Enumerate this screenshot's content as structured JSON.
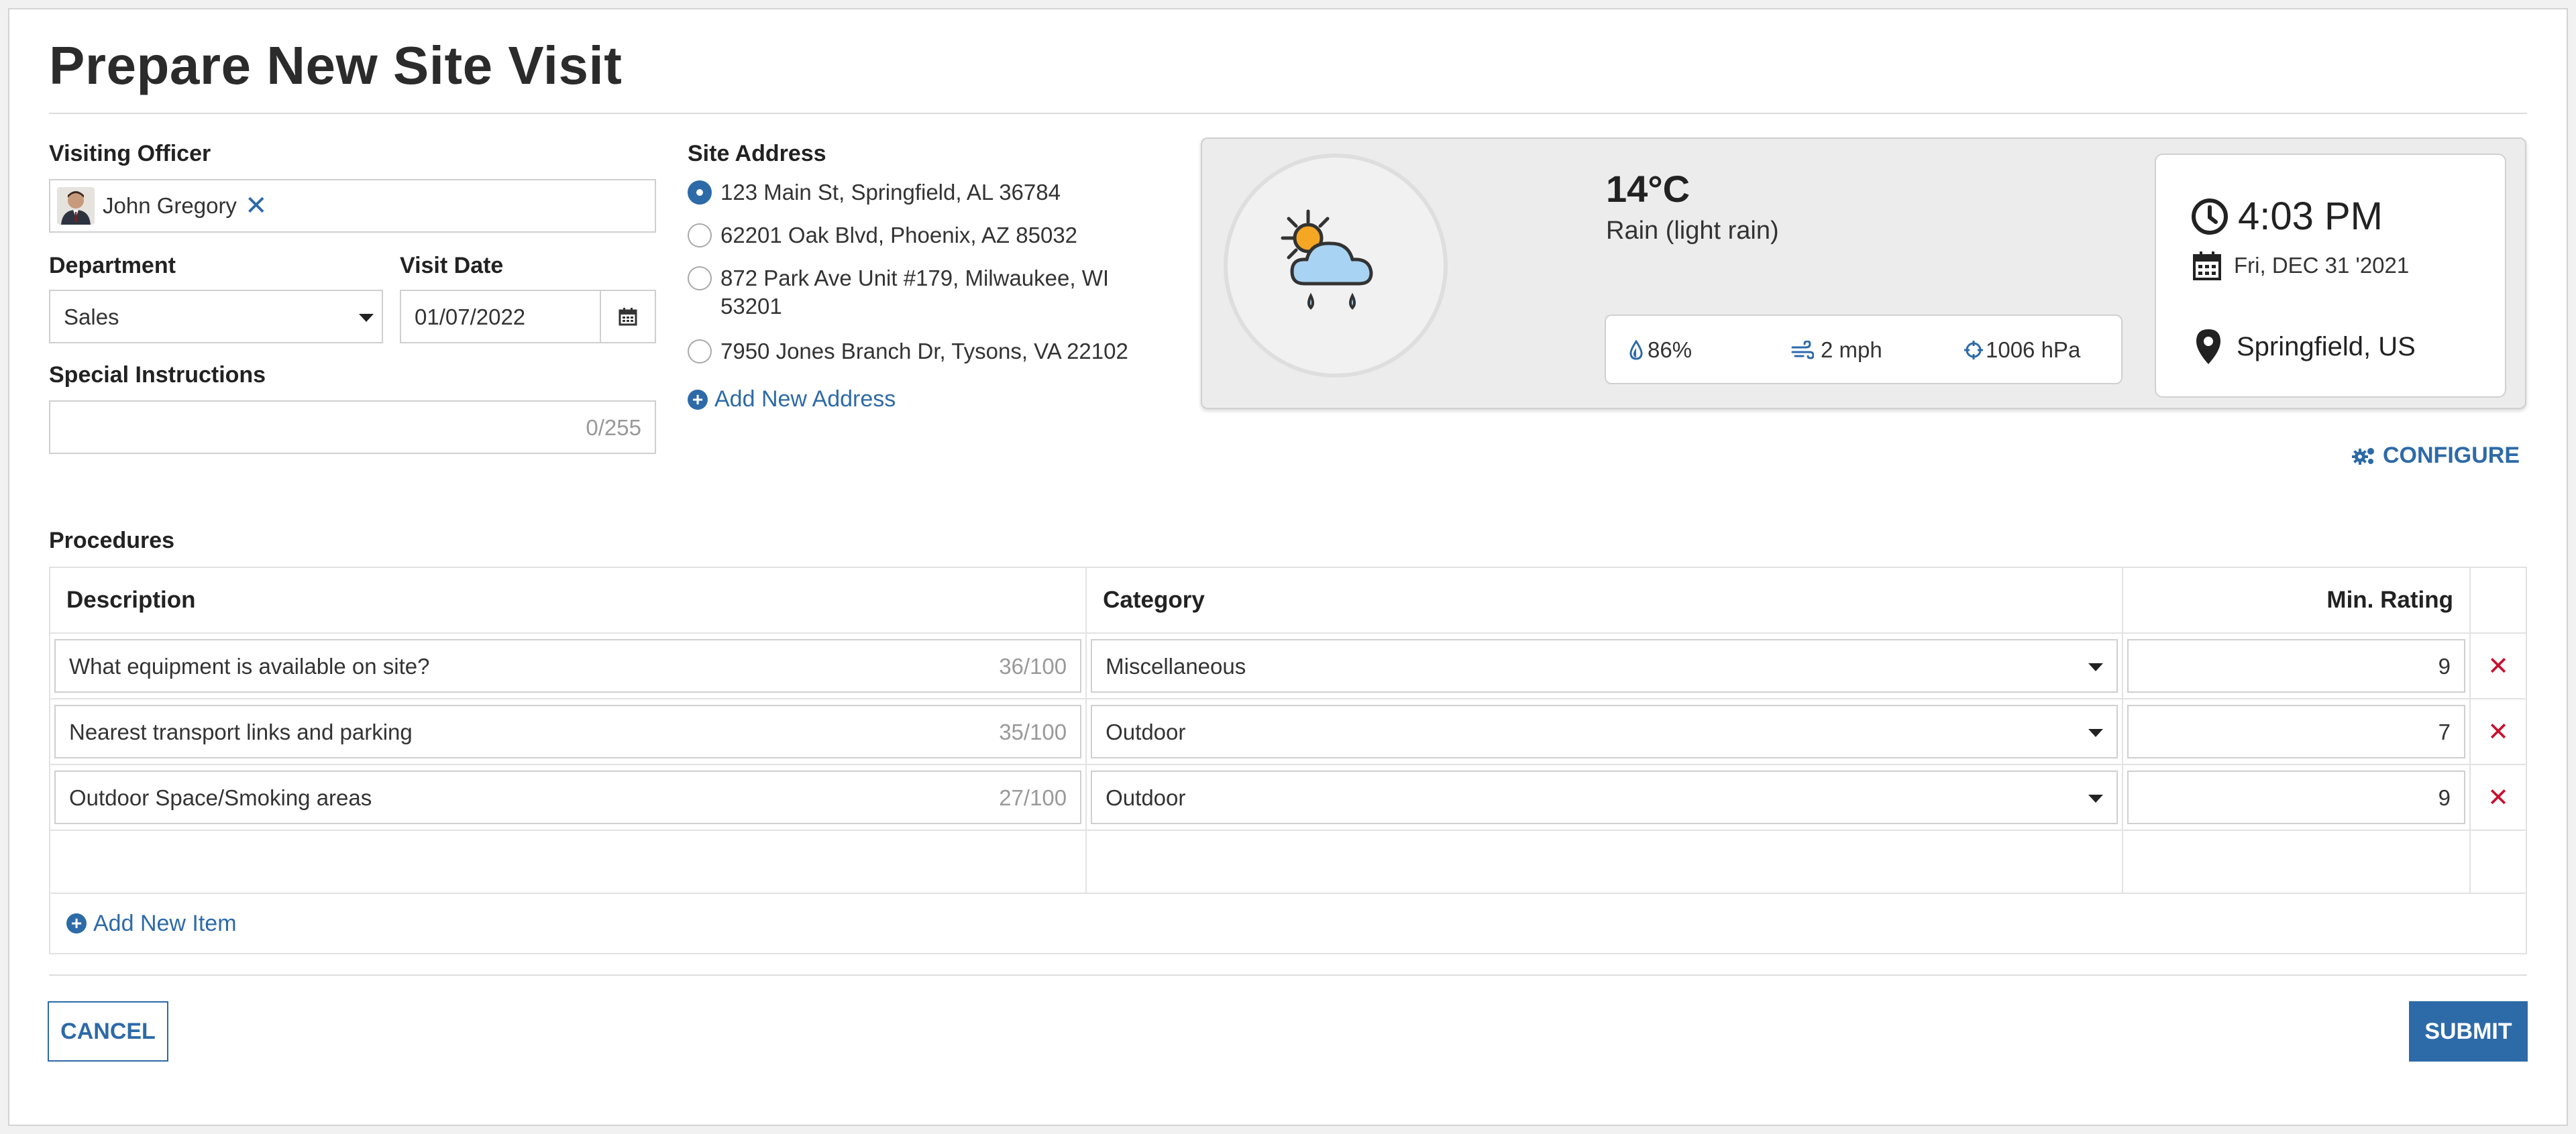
{
  "page": {
    "title": "Prepare New Site Visit"
  },
  "officer": {
    "label": "Visiting Officer",
    "name": "John Gregory"
  },
  "department": {
    "label": "Department",
    "value": "Sales"
  },
  "visit_date": {
    "label": "Visit Date",
    "value": "01/07/2022"
  },
  "special": {
    "label": "Special Instructions",
    "counter": "0/255",
    "value": ""
  },
  "site": {
    "label": "Site Address",
    "addresses": [
      {
        "line1": "123 Main St, Springfield, AL 36784",
        "line2": "",
        "selected": true
      },
      {
        "line1": "62201 Oak Blvd, Phoenix, AZ 85032",
        "line2": "",
        "selected": false
      },
      {
        "line1": "872 Park Ave Unit #179, Milwaukee, WI",
        "line2": "53201",
        "selected": false
      },
      {
        "line1": "7950 Jones Branch Dr, Tysons, VA 22102",
        "line2": "",
        "selected": false
      }
    ],
    "add_label": "Add New Address"
  },
  "weather": {
    "icon": "partly-cloudy-rain-icon",
    "temperature": "14°C",
    "condition": "Rain (light rain)",
    "humidity": "86%",
    "wind": "2 mph",
    "pressure": "1006 hPa",
    "time": "4:03 PM",
    "date": "Fri, DEC 31 '2021",
    "location": "Springfield, US",
    "configure_label": "CONFIGURE"
  },
  "procedures": {
    "label": "Procedures",
    "columns": {
      "description": "Description",
      "category": "Category",
      "rating": "Min. Rating"
    },
    "rows": [
      {
        "description": "What equipment is available on site?",
        "counter": "36/100",
        "category": "Miscellaneous",
        "rating": "9"
      },
      {
        "description": "Nearest transport links and parking",
        "counter": "35/100",
        "category": "Outdoor",
        "rating": "7"
      },
      {
        "description": "Outdoor Space/Smoking areas",
        "counter": "27/100",
        "category": "Outdoor",
        "rating": "9"
      }
    ],
    "add_label": "Add New Item"
  },
  "actions": {
    "cancel_label": "CANCEL",
    "submit_label": "SUBMIT"
  },
  "colors": {
    "accent": "#2d6aa8",
    "delete": "#c8102e",
    "sun": "#f5a623",
    "cloud": "#a9d3f2"
  }
}
